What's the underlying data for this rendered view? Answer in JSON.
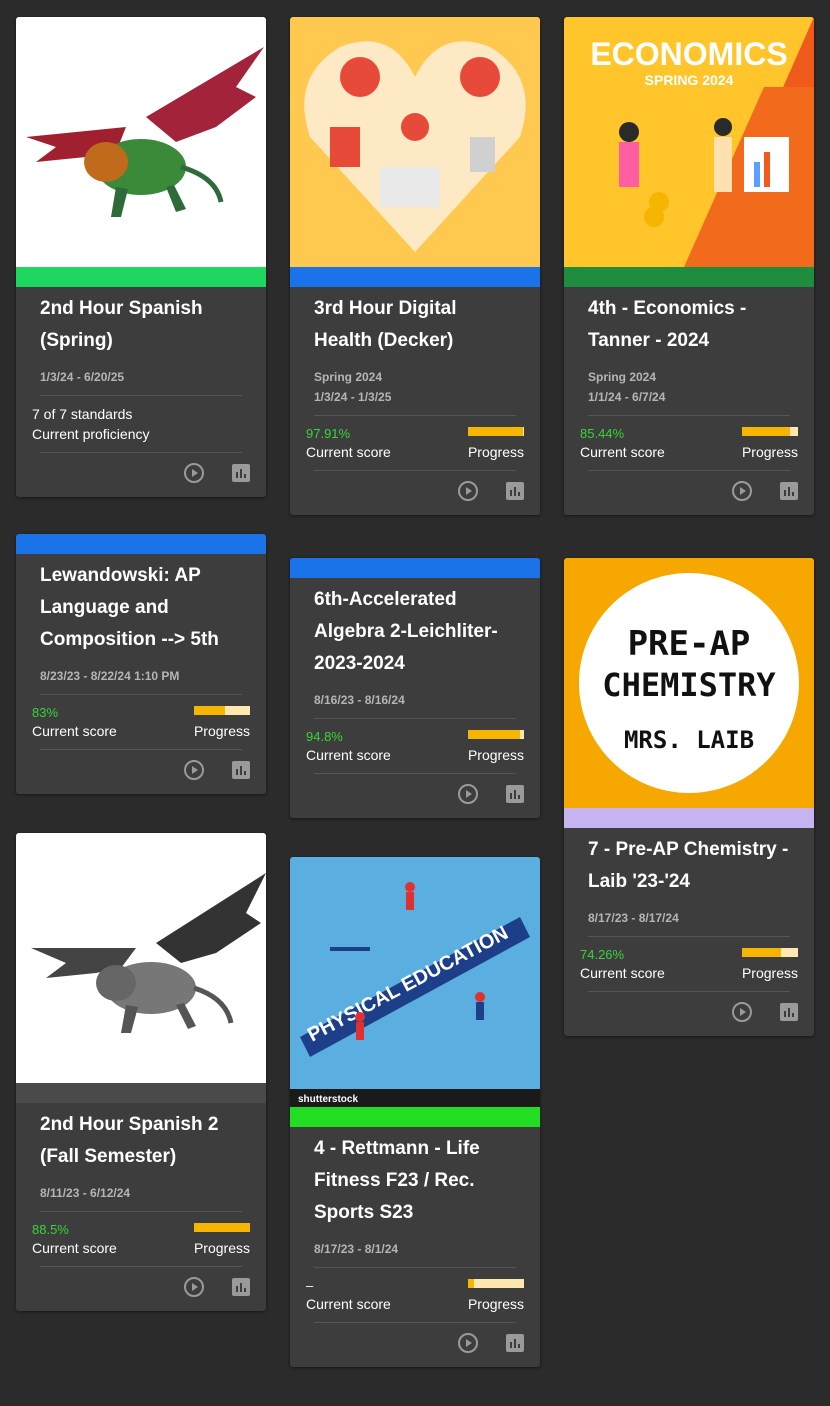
{
  "cards": {
    "c1": {
      "title": "2nd Hour Spanish (Spring)",
      "dates": "1/3/24 - 6/20/25",
      "standards": "7 of 7 standards",
      "proficiency": "Current proficiency",
      "band_color": "#1ed760"
    },
    "c2": {
      "title": "3rd Hour Digital Health (Decker)",
      "term": "Spring 2024",
      "dates": "1/3/24 - 1/3/25",
      "score": "97.91%",
      "score_label": "Current score",
      "progress_label": "Progress",
      "progress": 0.98,
      "band_color": "#1a73e8"
    },
    "c3": {
      "title": "4th - Economics - Tanner - 2024",
      "term": "Spring 2024",
      "dates": "1/1/24 - 6/7/24",
      "score": "85.44%",
      "score_label": "Current score",
      "progress_label": "Progress",
      "progress": 0.85,
      "band_color": "#1e8e3e",
      "image_heading": "ECONOMICS",
      "image_sub": "SPRING 2024"
    },
    "c4": {
      "title": "Lewandowski: AP Language and Composition --> 5th",
      "dates": "8/23/23 - 8/22/24 1:10 PM",
      "score": "83%",
      "score_label": "Current score",
      "progress_label": "Progress",
      "progress": 0.55,
      "band_color": "#1a73e8"
    },
    "c5": {
      "title": "6th-Accelerated Algebra 2-Leichliter-2023-2024",
      "dates": "8/16/23 - 8/16/24",
      "score": "94.8%",
      "score_label": "Current score",
      "progress_label": "Progress",
      "progress": 0.93,
      "band_color": "#1a73e8"
    },
    "c6": {
      "title": "7 - Pre-AP Chemistry - Laib '23-'24",
      "dates": "8/17/23 - 8/17/24",
      "score": "74.26%",
      "score_label": "Current score",
      "progress_label": "Progress",
      "progress": 0.7,
      "band_color": "#c6b4f0",
      "image_line1": "PRE-AP",
      "image_line2": "CHEMISTRY",
      "image_line3": "MRS. LAIB"
    },
    "c7": {
      "title": "2nd Hour Spanish 2 (Fall Semester)",
      "dates": "8/11/23 - 6/12/24",
      "score": "88.5%",
      "score_label": "Current score",
      "progress_label": "Progress",
      "progress": 1.0,
      "band_color": "#4a4a4a"
    },
    "c8": {
      "title": "4 - Rettmann - Life Fitness F23 / Rec. Sports S23",
      "dates": "8/17/23 - 8/1/24",
      "score": "–",
      "score_label": "Current score",
      "progress_label": "Progress",
      "progress": 0.1,
      "band_color": "#22dd22",
      "image_text": "PHYSICAL EDUCATION",
      "image_credit": "shutterstock"
    }
  }
}
